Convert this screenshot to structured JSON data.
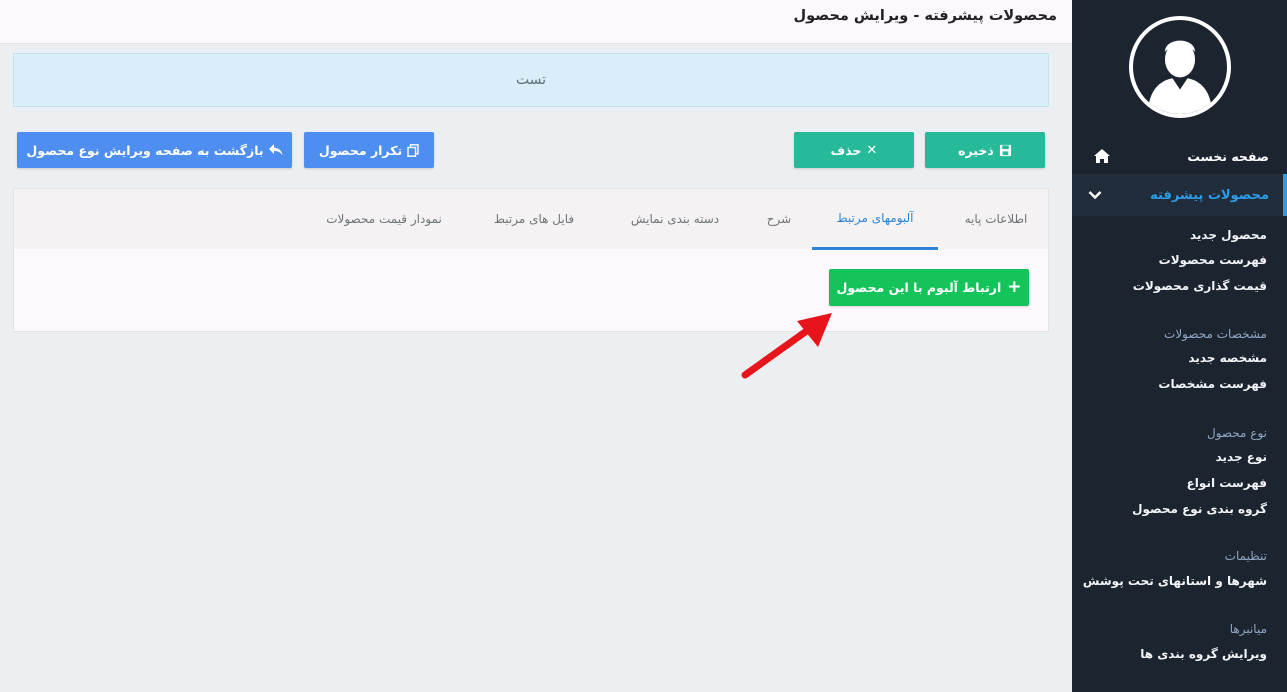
{
  "header": {
    "title": "محصولات پیشرفته - ویرایش محصول"
  },
  "banner": {
    "text": "تست"
  },
  "toolbar": {
    "save_label": "ذخیره",
    "delete_label": "حذف",
    "duplicate_label": "تکرار محصول",
    "back_label": "بازگشت به صفحه ویرایش نوع محصول"
  },
  "tabs": [
    {
      "label": "اطلاعات پایه"
    },
    {
      "label": "آلبومهای مرتبط"
    },
    {
      "label": "شرح"
    },
    {
      "label": "دسته بندی نمایش"
    },
    {
      "label": "فایل های مرتبط"
    },
    {
      "label": "نمودار قیمت محصولات"
    }
  ],
  "panel": {
    "link_album_label": "ارتباط آلبوم با این محصول"
  },
  "sidebar": {
    "home_label": "صفحه نخست",
    "active_label": "محصولات پیشرفته",
    "products": [
      "محصول جدید",
      "فهرست محصولات",
      "قیمت گذاری محصولات"
    ],
    "specs_heading": "مشخصات محصولات",
    "specs": [
      "مشخصه جدید",
      "فهرست مشخصات"
    ],
    "types_heading": "نوع محصول",
    "types": [
      "نوع جدید",
      "فهرست انواع",
      "گروه بندی نوع محصول"
    ],
    "settings_heading": "تنظیمات",
    "settings": [
      "شهرها و استانهای تحت پوشش"
    ],
    "shortcuts_heading": "میانبرها",
    "shortcuts": [
      "ویرایش گروه بندی ها"
    ]
  },
  "colors": {
    "sidebar_bg": "#1c2430",
    "accent": "#2d9ce8",
    "teal": "#26b99a",
    "blue": "#4d8ef0",
    "green": "#14c45a",
    "arrow": "#e8141c"
  }
}
